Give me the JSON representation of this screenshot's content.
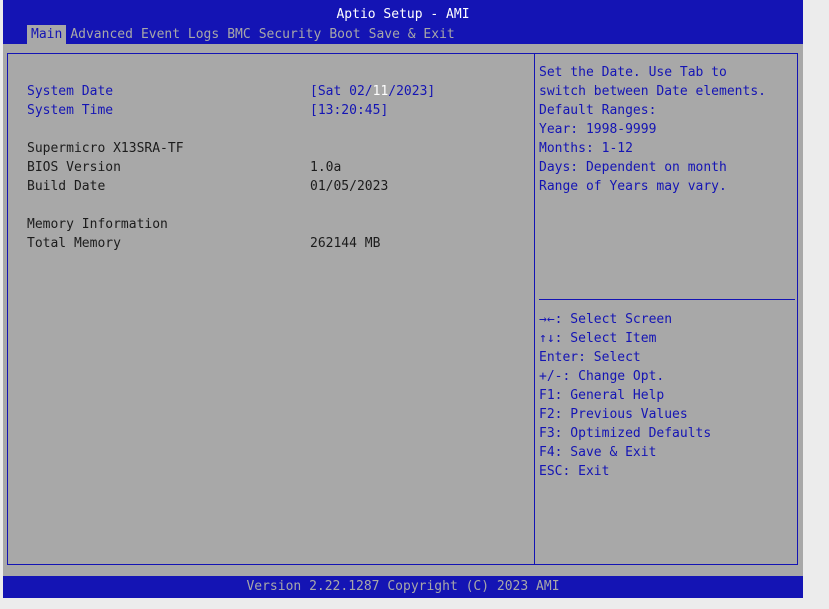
{
  "header": {
    "title": "Aptio Setup - AMI",
    "tabs": [
      {
        "label": "Main"
      },
      {
        "label": "Advanced"
      },
      {
        "label": "Event Logs"
      },
      {
        "label": "BMC"
      },
      {
        "label": "Security"
      },
      {
        "label": "Boot"
      },
      {
        "label": "Save & Exit"
      }
    ],
    "active_tab": "Main"
  },
  "main": {
    "system_date": {
      "label": "System Date",
      "prefix": "[Sat 02/",
      "highlight": "11",
      "suffix": "/2023]"
    },
    "system_time": {
      "label": "System Time",
      "value": "[13:20:45]"
    },
    "board_name": "Supermicro X13SRA-TF",
    "bios_version": {
      "label": "BIOS Version",
      "value": "1.0a"
    },
    "build_date": {
      "label": "Build Date",
      "value": "01/05/2023"
    },
    "memory_heading": "Memory Information",
    "total_memory": {
      "label": "Total Memory",
      "value": "262144 MB"
    }
  },
  "help": {
    "description": [
      "Set the Date. Use Tab to",
      "switch between Date elements.",
      "Default Ranges:",
      "Year: 1998-9999",
      "Months: 1-12",
      "Days: Dependent on month",
      "Range of Years may vary."
    ],
    "keys": [
      "→←: Select Screen",
      "↑↓: Select Item",
      "Enter: Select",
      "+/-: Change Opt.",
      "F1: General Help",
      "F2: Previous Values",
      "F3: Optimized Defaults",
      "F4: Save & Exit",
      "ESC: Exit"
    ]
  },
  "footer": {
    "text": "Version 2.22.1287 Copyright (C) 2023 AMI"
  },
  "colors": {
    "blue": "#1414b4",
    "grey": "#a8a8a8",
    "text": "#1c1c1c",
    "white": "#ffffff"
  }
}
